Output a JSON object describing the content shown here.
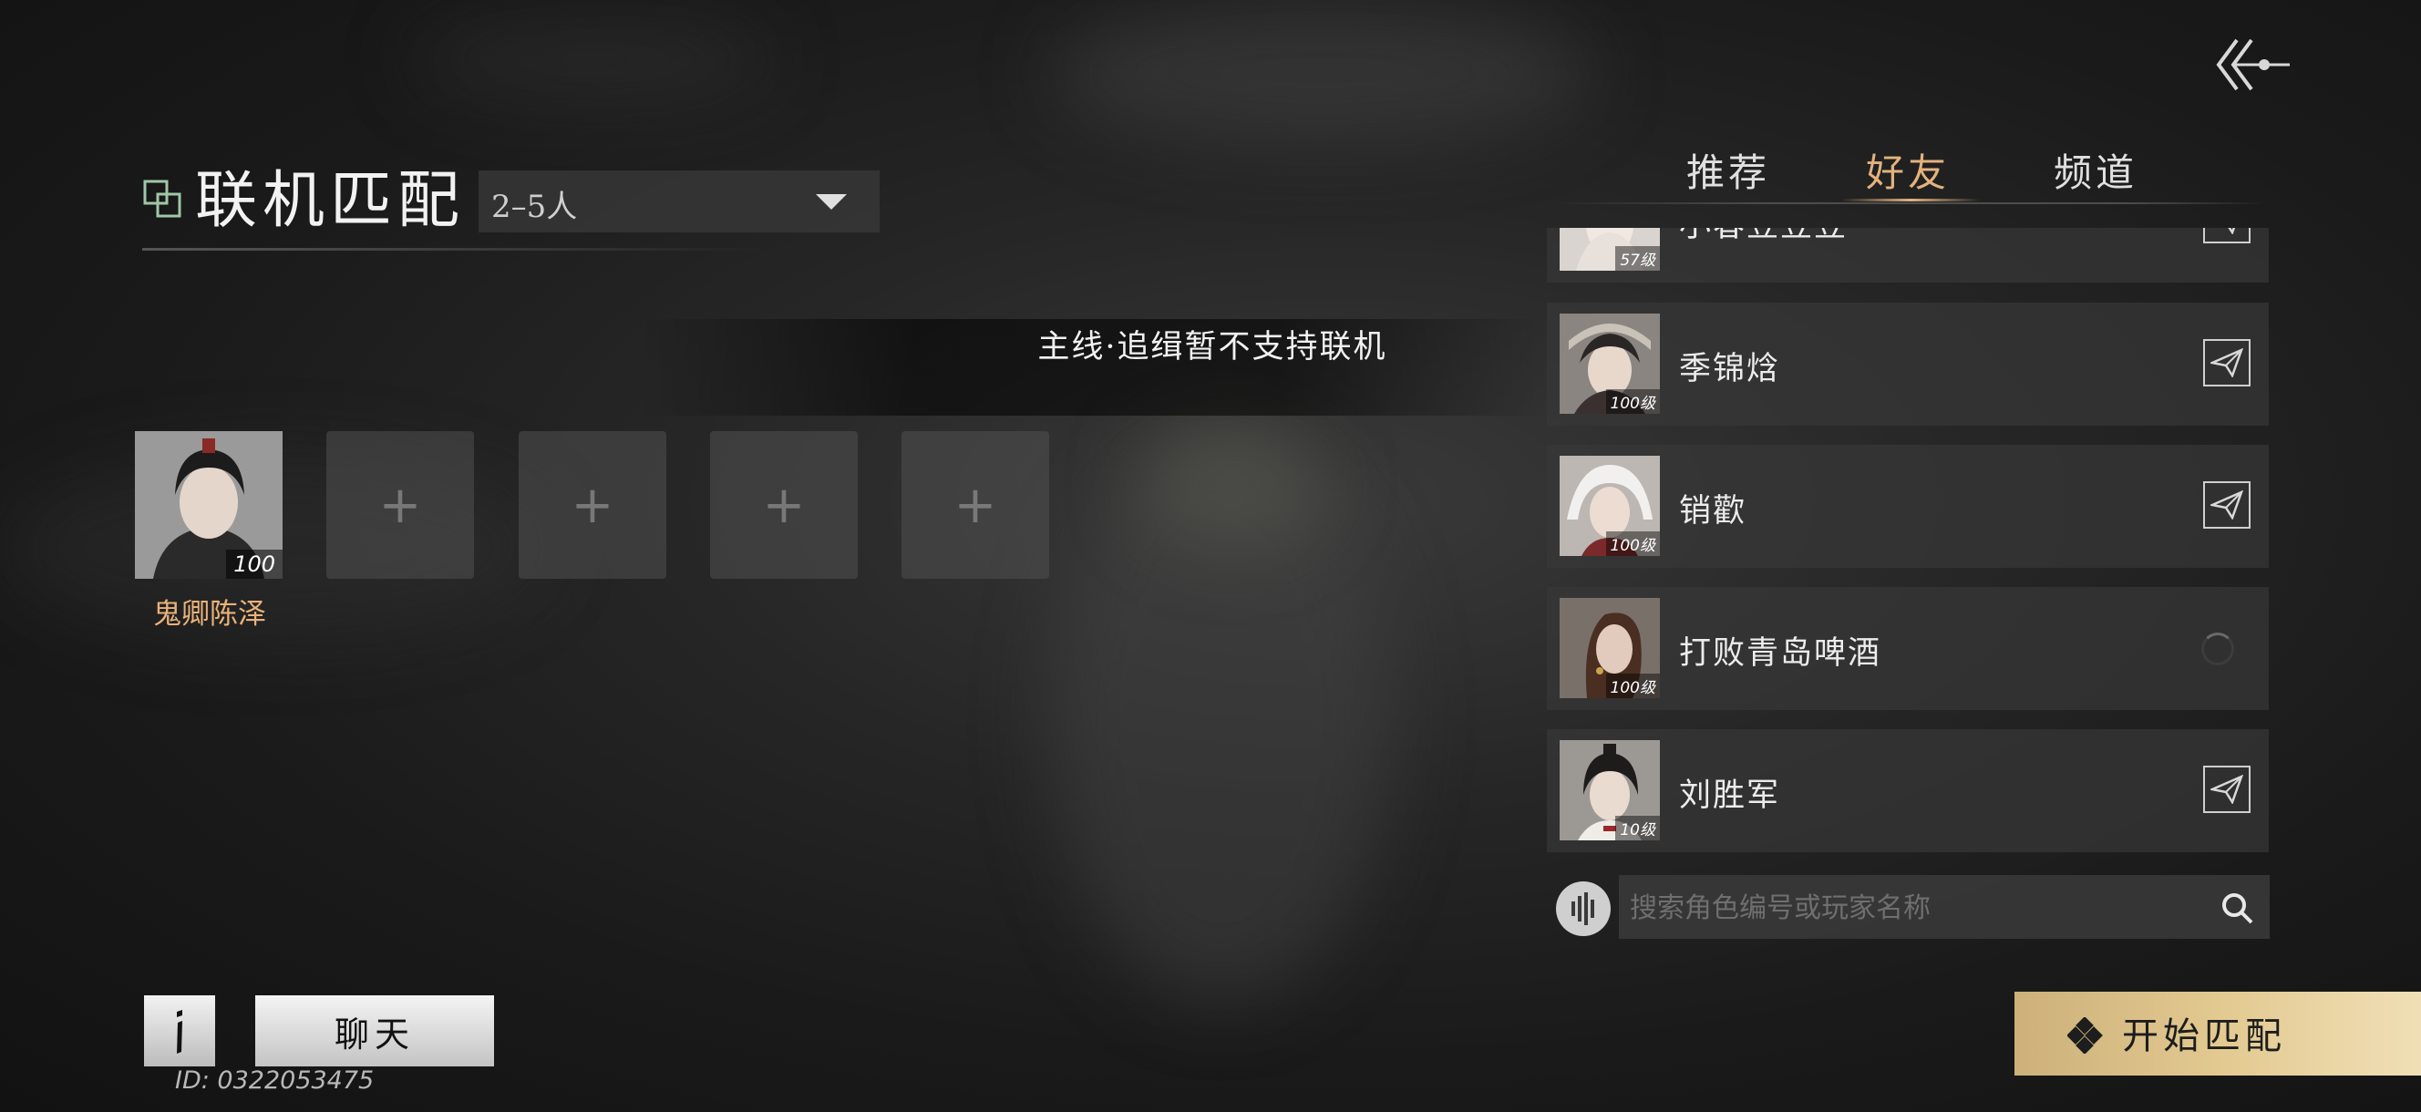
{
  "header": {
    "title": "联机匹配",
    "party_size": "2–5人"
  },
  "notice": "主线·追缉暂不支持联机",
  "team": {
    "leader": {
      "name": "鬼卿陈泽",
      "level": "100"
    },
    "empty_slots": [
      "+",
      "+",
      "+",
      "+"
    ]
  },
  "tabs": [
    {
      "label": "推荐",
      "active": false
    },
    {
      "label": "好友",
      "active": true
    },
    {
      "label": "频道",
      "active": false
    }
  ],
  "friends": [
    {
      "name": "小春豆豆豆",
      "level": "57级",
      "status": "invite"
    },
    {
      "name": "季锦焓",
      "level": "100级",
      "status": "invite"
    },
    {
      "name": "销歡",
      "level": "100级",
      "status": "invite"
    },
    {
      "name": "打败青岛啤酒",
      "level": "100级",
      "status": "loading"
    },
    {
      "name": "刘胜军",
      "level": "10级",
      "status": "invite"
    }
  ],
  "search": {
    "placeholder": "搜索角色编号或玩家名称"
  },
  "footer": {
    "info_label": "i",
    "chat_label": "聊天",
    "player_id": "ID: 0322053475",
    "start_label": "开始匹配"
  },
  "colors": {
    "accent_gold": "#e3b27d",
    "start_button": "#e2c990"
  },
  "icons": {
    "back": "back-arrow-icon",
    "match": "match-icon",
    "invite": "paper-plane-icon",
    "voice": "voice-icon",
    "search": "search-icon",
    "start": "diamond-icon"
  }
}
